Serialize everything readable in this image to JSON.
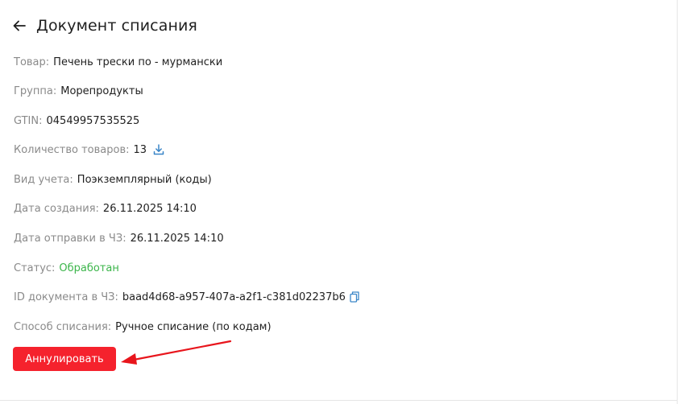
{
  "header": {
    "title": "Документ списания",
    "back_icon": "arrow-left-icon"
  },
  "fields": {
    "product": {
      "label": "Товар",
      "value": "Печень трески по - мурмански"
    },
    "group": {
      "label": "Группа",
      "value": "Морепродукты"
    },
    "gtin": {
      "label": "GTIN",
      "value": "04549957535525"
    },
    "quantity": {
      "label": "Количество товаров",
      "value": "13",
      "icon": "download-icon"
    },
    "accounting": {
      "label": "Вид учета",
      "value": "Поэкземплярный (коды)"
    },
    "created": {
      "label": "Дата создания",
      "value": "26.11.2025 14:10"
    },
    "sent": {
      "label": "Дата отправки в ЧЗ",
      "value": "26.11.2025 14:10"
    },
    "status": {
      "label": "Статус",
      "value": "Обработан",
      "color": "#3bb54a"
    },
    "doc_id": {
      "label": "ID документа в ЧЗ",
      "value": "baad4d68-a957-407a-a2f1-c381d02237b6",
      "icon": "copy-icon"
    },
    "method": {
      "label": "Способ списания",
      "value": "Ручное списание (по кодам)"
    }
  },
  "colon": ":",
  "actions": {
    "cancel_label": "Аннулировать",
    "cancel_color": "#f5222d"
  },
  "annotation": {
    "arrow_color": "#e8151c"
  }
}
